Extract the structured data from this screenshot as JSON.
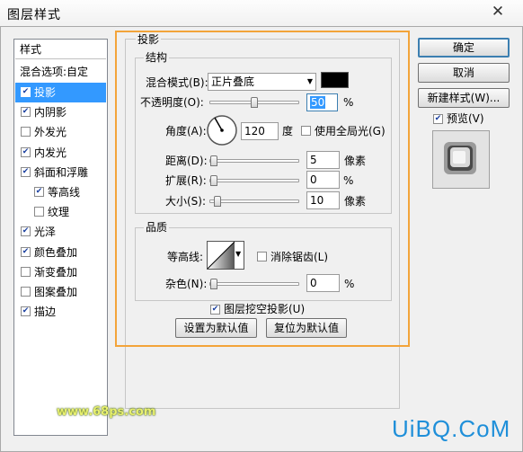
{
  "window": {
    "title": "图层样式"
  },
  "sidebar": {
    "header": "样式",
    "blend_options": "混合选项:自定",
    "items": [
      {
        "label": "投影",
        "checked": true,
        "selected": true
      },
      {
        "label": "内阴影",
        "checked": true
      },
      {
        "label": "外发光",
        "checked": false
      },
      {
        "label": "内发光",
        "checked": true
      },
      {
        "label": "斜面和浮雕",
        "checked": true
      },
      {
        "label": "等高线",
        "checked": true,
        "indent": true
      },
      {
        "label": "纹理",
        "checked": false,
        "indent": true
      },
      {
        "label": "光泽",
        "checked": true
      },
      {
        "label": "颜色叠加",
        "checked": true
      },
      {
        "label": "渐变叠加",
        "checked": false
      },
      {
        "label": "图案叠加",
        "checked": false
      },
      {
        "label": "描边",
        "checked": true
      }
    ]
  },
  "panel": {
    "title": "投影",
    "structure": {
      "title": "结构",
      "blend_mode_label": "混合模式(B):",
      "blend_mode_value": "正片叠底",
      "shadow_color": "#000000",
      "opacity_label": "不透明度(O):",
      "opacity_value": "50",
      "opacity_unit": "%",
      "opacity_level": 0.5,
      "angle_label": "角度(A):",
      "angle_value": "120",
      "angle_unit": "度",
      "global_light_label": "使用全局光(G)",
      "global_light_checked": false,
      "distance_label": "距离(D):",
      "distance_value": "5",
      "distance_unit": "像素",
      "spread_label": "扩展(R):",
      "spread_value": "0",
      "spread_unit": "%",
      "size_label": "大小(S):",
      "size_value": "10",
      "size_unit": "像素"
    },
    "quality": {
      "title": "品质",
      "contour_label": "等高线:",
      "antialias_label": "消除锯齿(L)",
      "antialias_checked": false,
      "noise_label": "杂色(N):",
      "noise_value": "0",
      "noise_unit": "%"
    },
    "knockout_label": "图层挖空投影(U)",
    "knockout_checked": true,
    "make_default": "设置为默认值",
    "reset_default": "复位为默认值"
  },
  "buttons": {
    "ok": "确定",
    "cancel": "取消",
    "new_style": "新建样式(W)...",
    "preview_label": "预览(V)",
    "preview_checked": true
  },
  "watermarks": {
    "left": "www.68ps.com",
    "right": "UiBQ.CoM"
  },
  "icons": {
    "close": "close-icon",
    "dropdown": "chevron-down-icon",
    "check": "check-icon"
  }
}
